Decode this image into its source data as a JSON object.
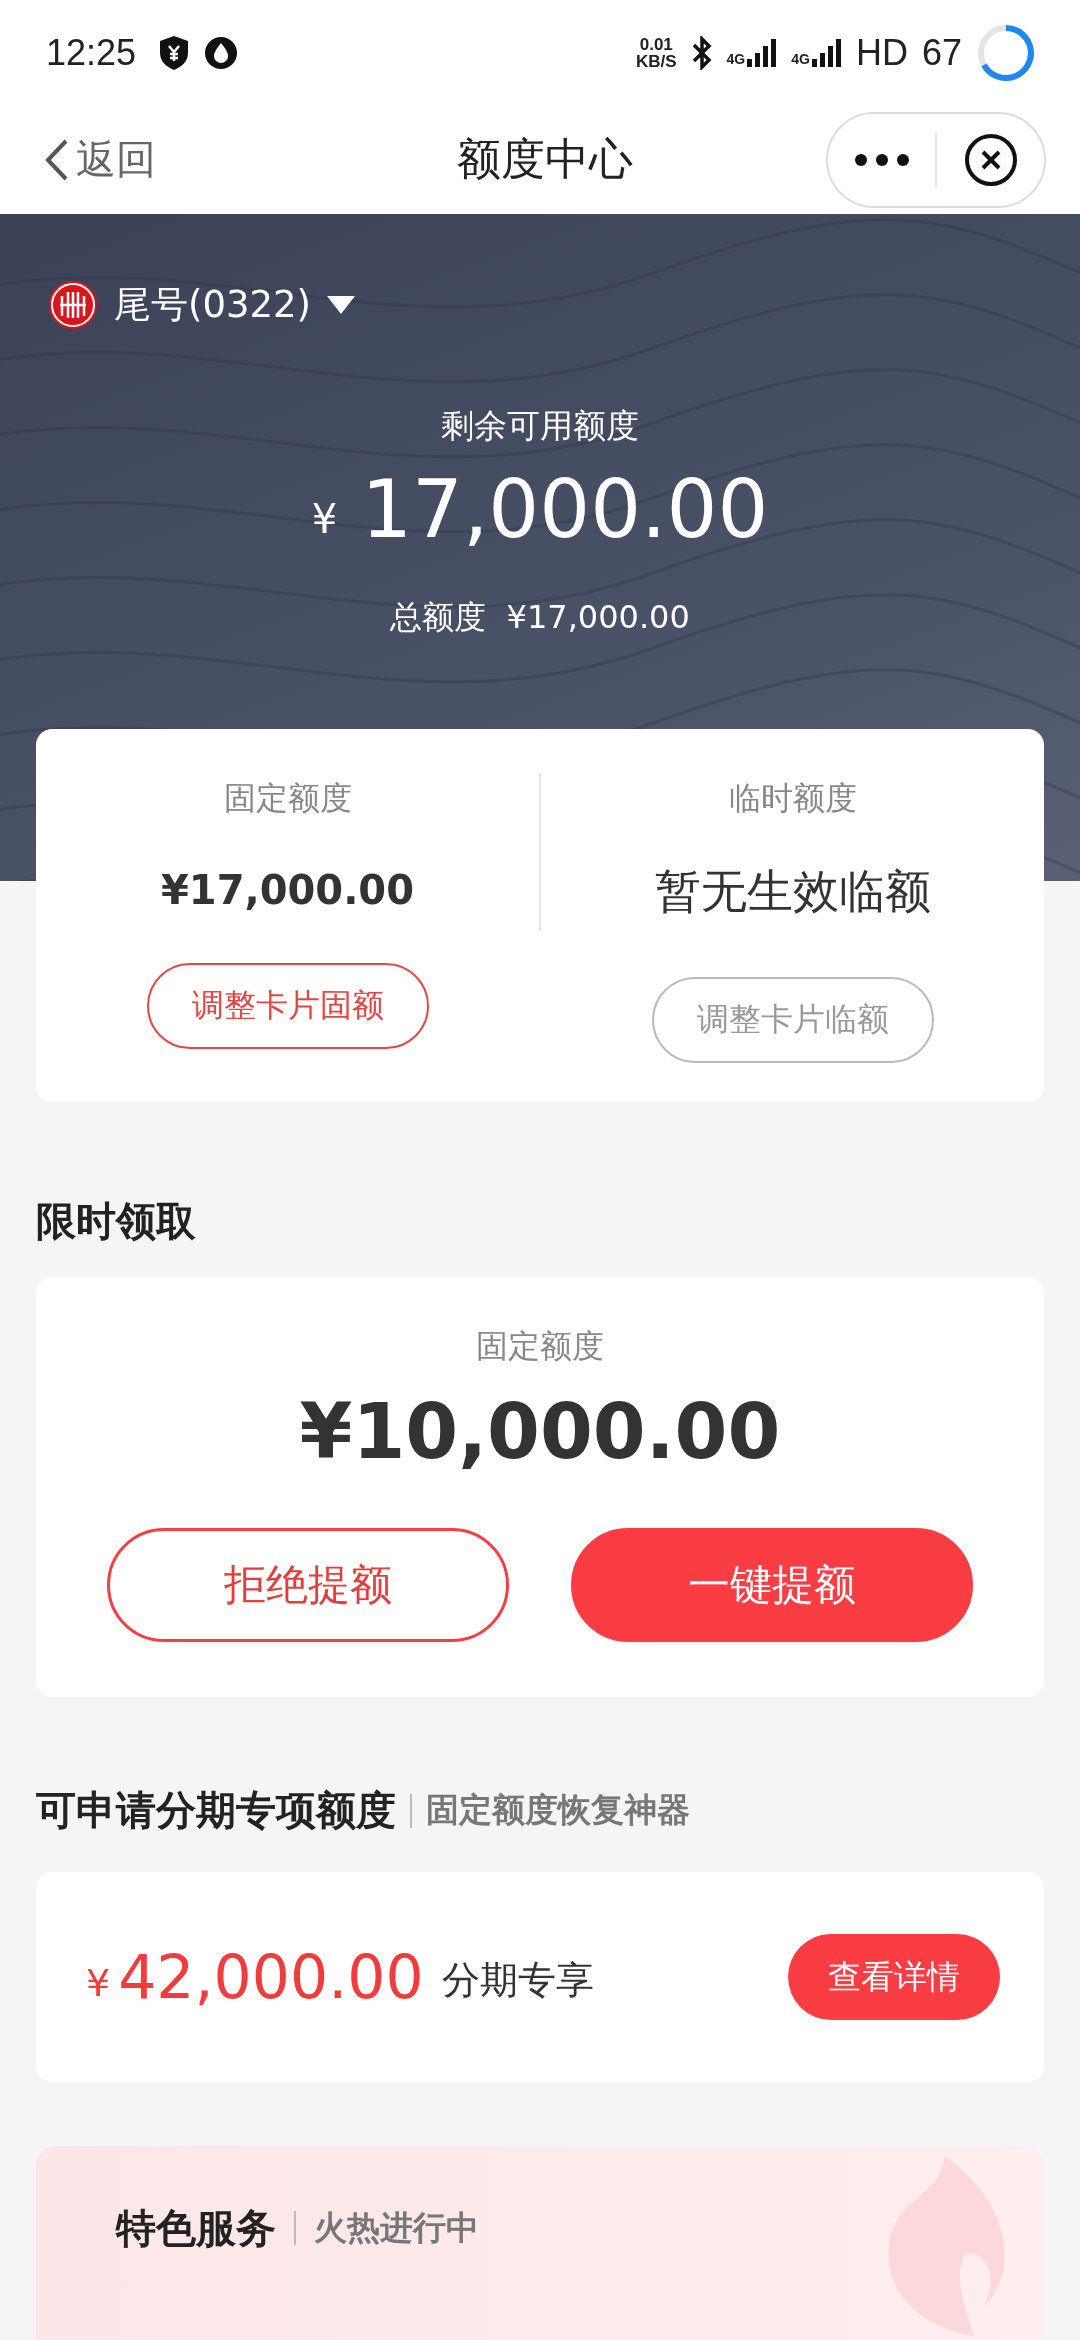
{
  "status_bar": {
    "time": "12:25",
    "net_speed": "0.01",
    "net_unit": "KB/S",
    "network_1": "4G",
    "network_2": "4G",
    "hd": "HD",
    "battery": "67"
  },
  "nav": {
    "back": "返回",
    "title": "额度中心"
  },
  "account": {
    "label": "尾号(0322)"
  },
  "summary": {
    "label": "剩余可用额度",
    "currency": "¥",
    "amount": "17,000.00",
    "total_label": "总额度",
    "total": "¥17,000.00"
  },
  "limits": [
    {
      "label": "固定额度",
      "value": "¥17,000.00",
      "kind": "amount",
      "button": "调整卡片固额",
      "disabled": false
    },
    {
      "label": "临时额度",
      "value": "暂无生效临额",
      "kind": "note",
      "button": "调整卡片临额",
      "disabled": true
    }
  ],
  "offer": {
    "section": "限时领取",
    "label": "固定额度",
    "currency": "¥",
    "amount": "10,000.00",
    "buttons": [
      {
        "label": "拒绝提额",
        "kind": "outline"
      },
      {
        "label": "一键提额",
        "kind": "primary"
      }
    ]
  },
  "installment": {
    "title": "可申请分期专项额度",
    "subtitle": "固定额度恢复神器",
    "currency": "¥",
    "amount": "42,000.00",
    "note": "分期专享",
    "button": "查看详情"
  },
  "special": {
    "title": "特色服务",
    "subtitle": "火热进行中"
  }
}
